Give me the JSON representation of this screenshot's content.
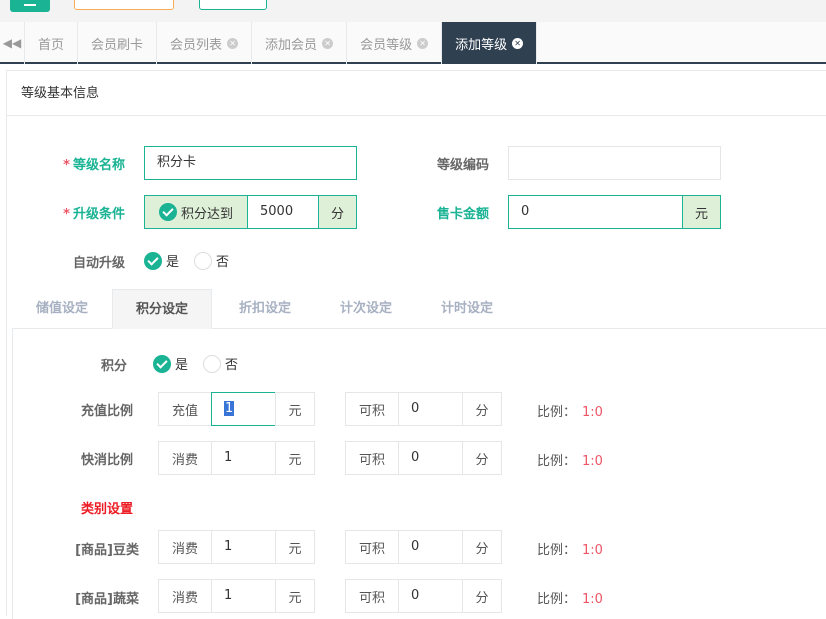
{
  "tabs": [
    {
      "label": "首页",
      "closable": false,
      "active": false
    },
    {
      "label": "会员刷卡",
      "closable": false,
      "active": false
    },
    {
      "label": "会员列表",
      "closable": true,
      "active": false
    },
    {
      "label": "添加会员",
      "closable": true,
      "active": false
    },
    {
      "label": "会员等级",
      "closable": true,
      "active": false
    },
    {
      "label": "添加等级",
      "closable": true,
      "active": true
    }
  ],
  "panel": {
    "title": "等级基本信息"
  },
  "form": {
    "level_name_label": "等级名称",
    "level_name_value": "积分卡",
    "level_code_label": "等级编码",
    "level_code_value": "",
    "upgrade_label": "升级条件",
    "upgrade_check_label": "积分达到",
    "upgrade_value": "5000",
    "upgrade_unit": "分",
    "card_price_label": "售卡金额",
    "card_price_value": "0",
    "card_price_unit": "元",
    "auto_upgrade_label": "自动升级",
    "yes": "是",
    "no": "否",
    "required_mark": "*"
  },
  "subtabs": [
    "储值设定",
    "积分设定",
    "折扣设定",
    "计次设定",
    "计时设定"
  ],
  "points": {
    "points_label": "积分",
    "yes": "是",
    "no": "否",
    "ratio_prefix": "比例：",
    "earn_label": "可积",
    "rows": [
      {
        "label": "充值比例",
        "prefix": "充值",
        "amount": "1",
        "amount_unit": "元",
        "earn": "0",
        "earn_unit": "分",
        "ratio": "1:0"
      },
      {
        "label": "快消比例",
        "prefix": "消费",
        "amount": "1",
        "amount_unit": "元",
        "earn": "0",
        "earn_unit": "分",
        "ratio": "1:0"
      }
    ],
    "category_title": "类别设置",
    "categories": [
      {
        "label": "[商品]豆类",
        "prefix": "消费",
        "amount": "1",
        "amount_unit": "元",
        "earn": "0",
        "earn_unit": "分",
        "ratio": "1:0"
      },
      {
        "label": "[商品]蔬菜",
        "prefix": "消费",
        "amount": "1",
        "amount_unit": "元",
        "earn": "0",
        "earn_unit": "分",
        "ratio": "1:0"
      }
    ]
  },
  "colors": {
    "accent": "#1ab394",
    "tab_active": "#2f4050",
    "danger": "#ed5565"
  }
}
